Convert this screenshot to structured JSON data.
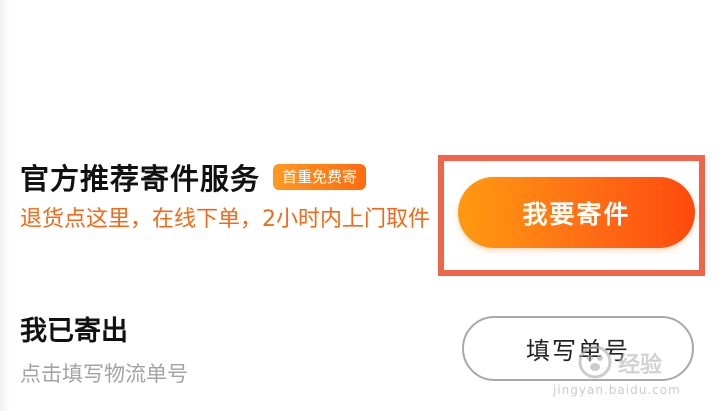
{
  "official_service": {
    "title": "官方推荐寄件服务",
    "badge": "首重免费寄",
    "description": "退货点这里，在线下单，2小时内上门取件",
    "button_label": "我要寄件"
  },
  "already_sent": {
    "title": "我已寄出",
    "description": "点击填写物流单号",
    "button_label": "填写单号"
  },
  "watermark": {
    "brand": "经验",
    "url": "jingyan.baidu.com"
  },
  "colors": {
    "accent_orange": "#ff6e14",
    "highlight_border": "#f0654a",
    "desc_orange": "#f26a17",
    "muted_gray": "#a3a3a3"
  }
}
